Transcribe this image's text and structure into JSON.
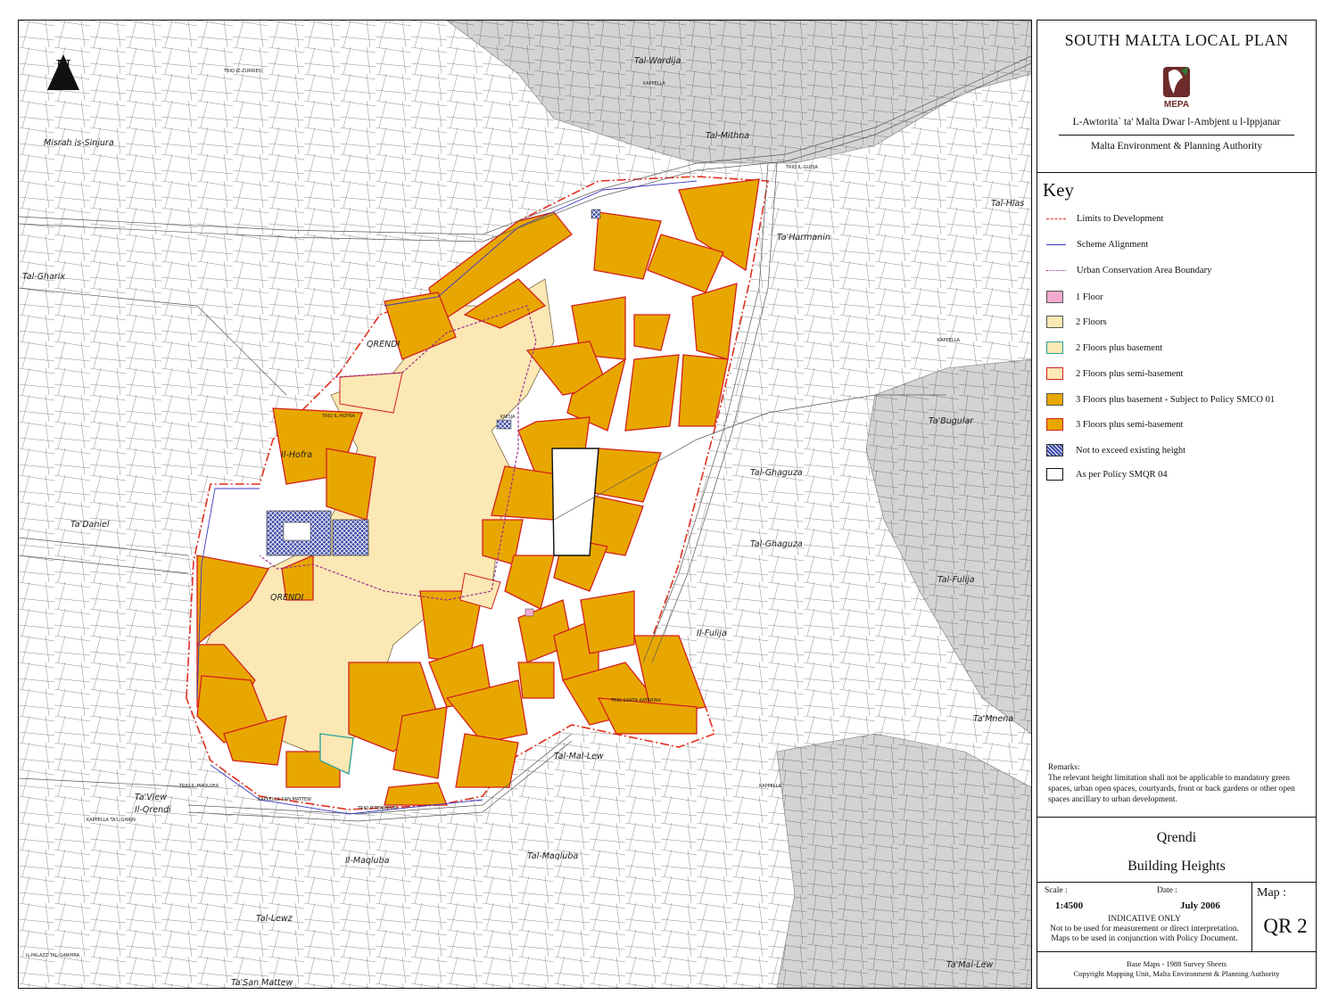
{
  "header": {
    "plan_title": "SOUTH MALTA LOCAL PLAN",
    "logo_text": "MEPA",
    "authority_mt": "L-Awtorita` ta' Malta Dwar l-Ambjent u l-Ippjanar",
    "authority_en": "Malta Environment & Planning Authority"
  },
  "north_label": "N",
  "key": {
    "title": "Key",
    "items": [
      {
        "label": "Limits to Development",
        "style": "line",
        "color": "#e03020"
      },
      {
        "label": "Scheme Alignment",
        "style": "line",
        "color": "#3a3ac0"
      },
      {
        "label": "Urban Conservation Area Boundary",
        "style": "line",
        "color": "#9b2d8c"
      },
      {
        "label": "1 Floor",
        "fill": "#f4a9cf",
        "border": "#555555"
      },
      {
        "label": "2 Floors",
        "fill": "#fbe8b4",
        "border": "#555555"
      },
      {
        "label": "2 Floors plus basement",
        "fill": "#fbe8b4",
        "border": "#2aa198"
      },
      {
        "label": "2 Floors plus semi-basement",
        "fill": "#fbe8b4",
        "border": "#d22020"
      },
      {
        "label": "3 Floors plus basement - Subject to Policy SMCO 01",
        "fill": "#e8a700",
        "border": "#555555"
      },
      {
        "label": "3 Floors plus semi-basement",
        "fill": "#e8a700",
        "border": "#d22020"
      },
      {
        "label": "Not to exceed existing height",
        "fill": "#3b4aa6",
        "border": "#333333"
      },
      {
        "label": "As per Policy SMQR 04",
        "fill": "#ffffff",
        "border": "#111111"
      }
    ]
  },
  "remarks": {
    "title": "Remarks:",
    "text": "The relevant height limitation shall not be applicable to mandatory green spaces, urban open spaces, courtyards, front or back gardens or other open spaces ancillary to urban development."
  },
  "map_info": {
    "place": "Qrendi",
    "map_name": "Building Heights",
    "scale_label": "Scale :",
    "scale_value": "1:4500",
    "date_label": "Date :",
    "date_value": "July 2006",
    "map_label": "Map :",
    "map_number": "QR 2",
    "note_title": "INDICATIVE ONLY",
    "note_line1": "Not to be used for measurement or direct interpretation.",
    "note_line2": "Maps to be used in conjunction with Policy Document."
  },
  "footer": {
    "base_maps": "Base Maps - 1988 Survey Sheets",
    "copyright": "Copyright Mapping Unit, Malta Environment & Planning Authority"
  },
  "place_names": {
    "misrah_is_sinjura": "Misrah is-Sinjura",
    "tal_wardija": "Tal-Wardija",
    "tal_mithna": "Tal-Mithna",
    "tal_gharix": "Tal-Gharix",
    "qrendi_n": "QRENDI",
    "qrendi_s": "QRENDI",
    "il_hofra": "Il-Hofra",
    "ta_daniel": "Ta'Daniel",
    "ta_harmanin": "Ta'Harmanin",
    "tal_hlas": "Tal-Hlas",
    "ta_bugular": "Ta'Bugular",
    "tal_ghaguza_1": "Tal-Ghaguza",
    "tal_ghaguza_2": "Tal-Ghaguza",
    "il_fulija": "Il-Fulija",
    "tal_fulija": "Tal-Fulija",
    "ta_mnena": "Ta'Mnena",
    "ta_vlew": "Ta'Vlew",
    "il_qrendi_s": "Il-Qrendi",
    "tal_maqluba_1": "Il-Maqluba",
    "tal_maqluba_2": "Tal-Maqluba",
    "tal_mal_lew": "Tal-Mal-Lew",
    "tal_lewz": "Tal-Lewz",
    "ta_mal_lew": "Ta'Mal-Lew",
    "ta_san_mattew": "Ta'San Mattew",
    "kappella_san_mattew": "KAPPELLA SAN MATTEW",
    "kappella_ta_maghtab": "KAPPELLA TA'L-GHAJN",
    "kappella_1": "KAPPELLA",
    "kappella_2": "KAPPELLA",
    "kappella_3": "KAPPELLA",
    "knisja": "KNISJA",
    "triq_it_tempesta": "TRIQ IT-TEMPESTA",
    "triq_il_gudja": "TRIQ IL-GUDJA",
    "triq_iz_zurrieq": "TRIQ IZ-ZURRIEQ",
    "triq_il_hofra": "TRIQ IL-HOFRA",
    "triq_il_maqluba": "TRIQ IL-MAQLUBA",
    "triq_santa_katarina": "TRIQ SANTA KATARINA",
    "il_palazz": "IL-PALAZZ TAL-GAWHRA"
  }
}
